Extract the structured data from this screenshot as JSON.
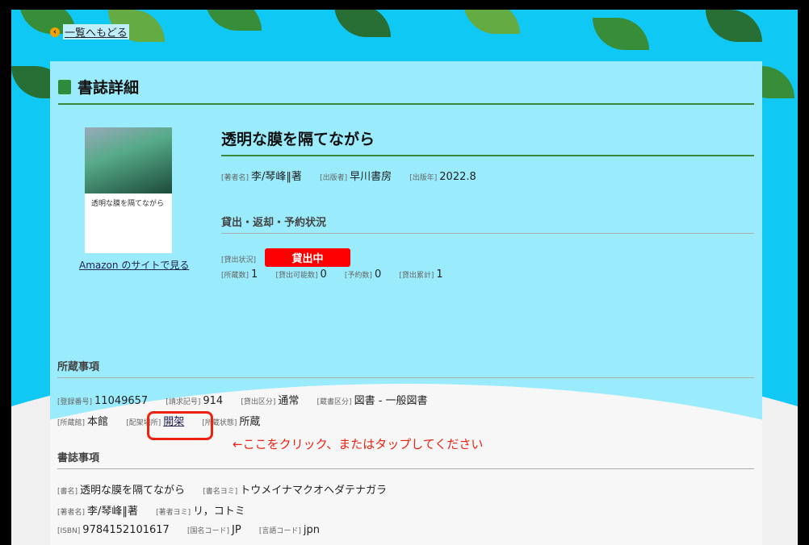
{
  "nav": {
    "back_label": "一覧へもどる"
  },
  "page_title": "書誌詳細",
  "book": {
    "title": "透明な膜を隔てながら",
    "cover_text": "透明な膜を隔てながら",
    "amazon_link": "Amazon のサイトで見る",
    "meta": [
      {
        "label": "[著者名]",
        "value": "李/琴峰‖著"
      },
      {
        "label": "[出版者]",
        "value": "早川書房"
      },
      {
        "label": "[出版年]",
        "value": "2022.8"
      }
    ]
  },
  "loan": {
    "heading": "貸出・返却・予約状況",
    "status_label": "[貸出状況]",
    "status_value": "貸出中",
    "status_color": "#ff0000",
    "counts": [
      {
        "label": "[所蔵数]",
        "value": "1"
      },
      {
        "label": "[貸出可能数]",
        "value": "0"
      },
      {
        "label": "[予約数]",
        "value": "0"
      },
      {
        "label": "[貸出累計]",
        "value": "1"
      }
    ]
  },
  "holdings": {
    "heading": "所蔵事項",
    "row1": [
      {
        "label": "[登録番号]",
        "value": "11049657"
      },
      {
        "label": "[請求記号]",
        "value": "914"
      },
      {
        "label": "[貸出区分]",
        "value": "通常"
      },
      {
        "label": "[蔵書区分]",
        "value": "図書 - 一般図書"
      }
    ],
    "row2": [
      {
        "label": "[所蔵館]",
        "value": "本館"
      },
      {
        "label": "[配架場所]",
        "value": "開架"
      },
      {
        "label": "[所蔵状態]",
        "value": "所蔵"
      }
    ]
  },
  "annotation": "←ここをクリック、またはタップしてください",
  "biblio": {
    "heading": "書誌事項",
    "row1": [
      {
        "label": "[書名]",
        "value": "透明な膜を隔てながら"
      },
      {
        "label": "[書名ヨミ]",
        "value": "トウメイナマクオヘダテナガラ"
      }
    ],
    "row2": [
      {
        "label": "[著者名]",
        "value": "李/琴峰‖著"
      },
      {
        "label": "[著者ヨミ]",
        "value": "リ，コトミ"
      }
    ],
    "row3": [
      {
        "label": "[ISBN]",
        "value": "9784152101617"
      },
      {
        "label": "[国名コード]",
        "value": "JP"
      },
      {
        "label": "[言語コード]",
        "value": "jpn"
      }
    ]
  }
}
